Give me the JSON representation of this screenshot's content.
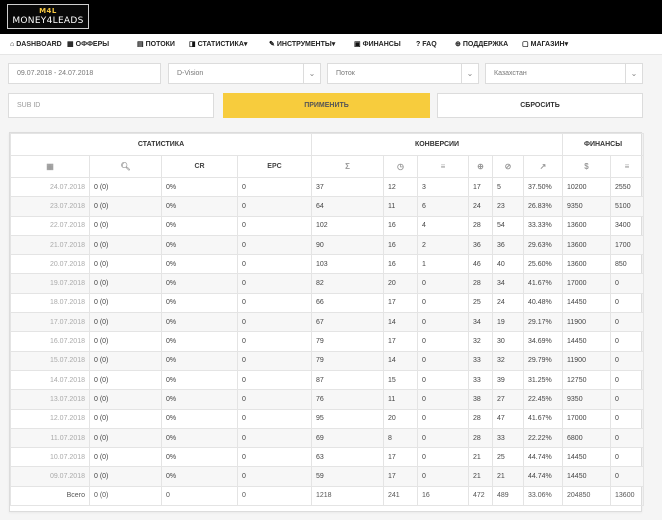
{
  "brand": {
    "badge": "M4L",
    "name": "MONEY4LEADS"
  },
  "nav": [
    {
      "icon": "⌂",
      "label": "DASHBOARD",
      "name": "nav-dashboard",
      "icon_name": "home-icon"
    },
    {
      "icon": "▦",
      "label": "ОФФЕРЫ",
      "name": "nav-offers",
      "icon_name": "grid-icon"
    },
    {
      "icon": "▤",
      "label": "ПОТОКИ",
      "name": "nav-streams",
      "icon_name": "list-icon"
    },
    {
      "icon": "◨",
      "label": "СТАТИСТИКА",
      "name": "nav-statistics",
      "icon_name": "chart-icon",
      "dropdown": true
    },
    {
      "icon": "✎",
      "label": "ИНСТРУМЕНТЫ",
      "name": "nav-tools",
      "icon_name": "wrench-icon",
      "dropdown": true
    },
    {
      "icon": "▣",
      "label": "ФИНАНСЫ",
      "name": "nav-finance",
      "icon_name": "wallet-icon"
    },
    {
      "icon": "?",
      "label": "FAQ",
      "name": "nav-faq",
      "icon_name": "question-icon"
    },
    {
      "icon": "⊕",
      "label": "ПОДДЕРЖКА",
      "name": "nav-support",
      "icon_name": "lifebuoy-icon"
    },
    {
      "icon": "▢",
      "label": "МАГАЗИН",
      "name": "nav-shop",
      "icon_name": "shop-icon",
      "dropdown": true
    }
  ],
  "nav_dropdown_glyph": "▾",
  "filters": {
    "date_range": "09.07.2018 - 24.07.2018",
    "offer": "D-Vision",
    "stream": "Поток",
    "country": "Казахстан",
    "caret": "⌄"
  },
  "sub_id_placeholder": "SUB ID",
  "apply_label": "ПРИМЕНИТЬ",
  "reset_label": "СБРОСИТЬ",
  "table": {
    "groups": {
      "stats": "СТАТИСТИКА",
      "conversions": "КОНВЕРСИИ",
      "finance": "ФИНАНСЫ"
    },
    "header_icons": [
      {
        "text": "▦",
        "name": "calendar-icon"
      },
      {
        "text": "🔍︎",
        "name": "clicks-icon"
      },
      {
        "text": "CR",
        "name": "cr-header"
      },
      {
        "text": "EPC",
        "name": "epc-header"
      },
      {
        "text": "Σ",
        "name": "total-icon"
      },
      {
        "text": "◷",
        "name": "pending-icon"
      },
      {
        "text": "≡",
        "name": "hold-icon"
      },
      {
        "text": "⊕",
        "name": "approved-icon"
      },
      {
        "text": "⊘",
        "name": "rejected-icon"
      },
      {
        "text": "↗",
        "name": "approve-rate-icon"
      },
      {
        "text": "$",
        "name": "dollar-icon"
      },
      {
        "text": "≡",
        "name": "hold-money-icon"
      }
    ],
    "rows": [
      [
        "24.07.2018",
        "0 (0)",
        "0%",
        "0",
        "37",
        "12",
        "3",
        "17",
        "5",
        "37.50%",
        "10200",
        "2550"
      ],
      [
        "23.07.2018",
        "0 (0)",
        "0%",
        "0",
        "64",
        "11",
        "6",
        "24",
        "23",
        "26.83%",
        "9350",
        "5100"
      ],
      [
        "22.07.2018",
        "0 (0)",
        "0%",
        "0",
        "102",
        "16",
        "4",
        "28",
        "54",
        "33.33%",
        "13600",
        "3400"
      ],
      [
        "21.07.2018",
        "0 (0)",
        "0%",
        "0",
        "90",
        "16",
        "2",
        "36",
        "36",
        "29.63%",
        "13600",
        "1700"
      ],
      [
        "20.07.2018",
        "0 (0)",
        "0%",
        "0",
        "103",
        "16",
        "1",
        "46",
        "40",
        "25.60%",
        "13600",
        "850"
      ],
      [
        "19.07.2018",
        "0 (0)",
        "0%",
        "0",
        "82",
        "20",
        "0",
        "28",
        "34",
        "41.67%",
        "17000",
        "0"
      ],
      [
        "18.07.2018",
        "0 (0)",
        "0%",
        "0",
        "66",
        "17",
        "0",
        "25",
        "24",
        "40.48%",
        "14450",
        "0"
      ],
      [
        "17.07.2018",
        "0 (0)",
        "0%",
        "0",
        "67",
        "14",
        "0",
        "34",
        "19",
        "29.17%",
        "11900",
        "0"
      ],
      [
        "16.07.2018",
        "0 (0)",
        "0%",
        "0",
        "79",
        "17",
        "0",
        "32",
        "30",
        "34.69%",
        "14450",
        "0"
      ],
      [
        "15.07.2018",
        "0 (0)",
        "0%",
        "0",
        "79",
        "14",
        "0",
        "33",
        "32",
        "29.79%",
        "11900",
        "0"
      ],
      [
        "14.07.2018",
        "0 (0)",
        "0%",
        "0",
        "87",
        "15",
        "0",
        "33",
        "39",
        "31.25%",
        "12750",
        "0"
      ],
      [
        "13.07.2018",
        "0 (0)",
        "0%",
        "0",
        "76",
        "11",
        "0",
        "38",
        "27",
        "22.45%",
        "9350",
        "0"
      ],
      [
        "12.07.2018",
        "0 (0)",
        "0%",
        "0",
        "95",
        "20",
        "0",
        "28",
        "47",
        "41.67%",
        "17000",
        "0"
      ],
      [
        "11.07.2018",
        "0 (0)",
        "0%",
        "0",
        "69",
        "8",
        "0",
        "28",
        "33",
        "22.22%",
        "6800",
        "0"
      ],
      [
        "10.07.2018",
        "0 (0)",
        "0%",
        "0",
        "63",
        "17",
        "0",
        "21",
        "25",
        "44.74%",
        "14450",
        "0"
      ],
      [
        "09.07.2018",
        "0 (0)",
        "0%",
        "0",
        "59",
        "17",
        "0",
        "21",
        "21",
        "44.74%",
        "14450",
        "0"
      ]
    ],
    "total": [
      "Всего",
      "0 (0)",
      "0",
      "0",
      "1218",
      "241",
      "16",
      "472",
      "489",
      "33.06%",
      "204850",
      "13600"
    ]
  }
}
